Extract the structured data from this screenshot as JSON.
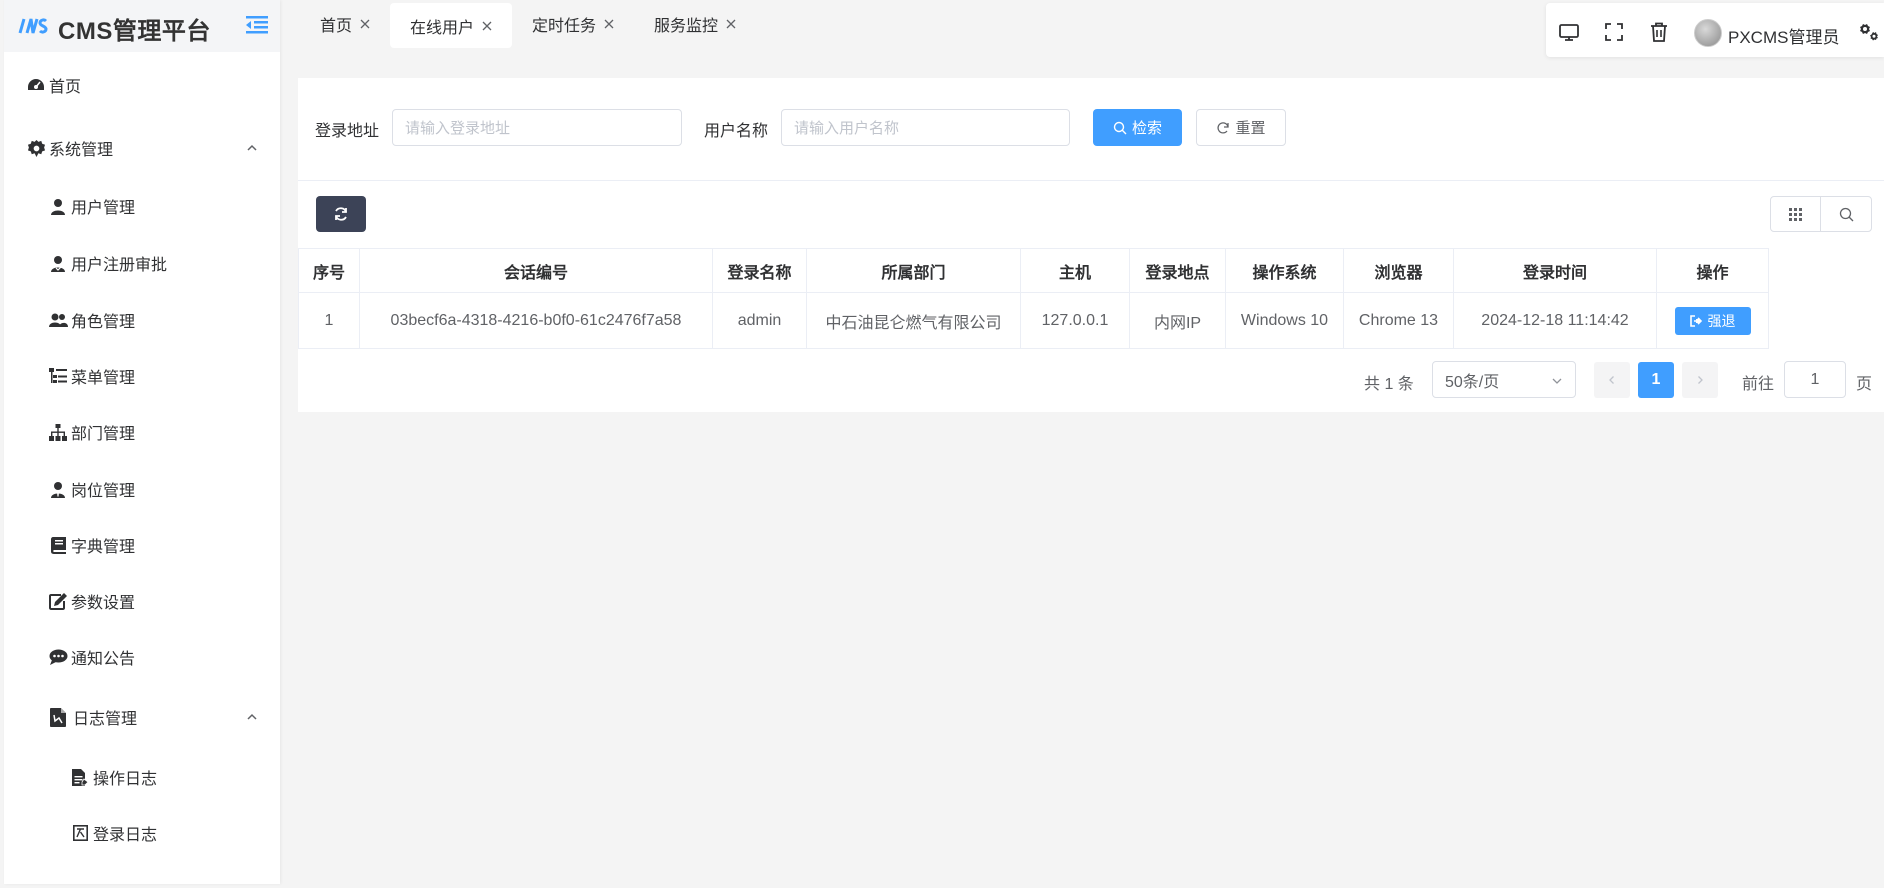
{
  "app": {
    "title": "CMS管理平台"
  },
  "colors": {
    "primary": "#409eff",
    "dark_button": "#3c4357",
    "sidebar_bg": "#ffffff",
    "page_bg": "#f4f4f4"
  },
  "sidebar": {
    "items": [
      {
        "label": "首页",
        "icon": "dashboard-icon"
      },
      {
        "label": "系统管理",
        "icon": "gear-icon",
        "expanded": true
      },
      {
        "label": "用户管理",
        "icon": "user-icon"
      },
      {
        "label": "用户注册审批",
        "icon": "user-check-icon"
      },
      {
        "label": "角色管理",
        "icon": "users-icon"
      },
      {
        "label": "菜单管理",
        "icon": "tree-list-icon"
      },
      {
        "label": "部门管理",
        "icon": "sitemap-icon"
      },
      {
        "label": "岗位管理",
        "icon": "user-tie-icon"
      },
      {
        "label": "字典管理",
        "icon": "book-icon"
      },
      {
        "label": "参数设置",
        "icon": "edit-icon"
      },
      {
        "label": "通知公告",
        "icon": "comments-icon"
      },
      {
        "label": "日志管理",
        "icon": "log-file-icon",
        "expanded": true
      },
      {
        "label": "操作日志",
        "icon": "file-text-icon"
      },
      {
        "label": "登录日志",
        "icon": "login-log-icon"
      }
    ]
  },
  "tabs": [
    {
      "label": "首页"
    },
    {
      "label": "在线用户",
      "active": true
    },
    {
      "label": "定时任务"
    },
    {
      "label": "服务监控"
    }
  ],
  "toolbar": {
    "username": "PXCMS管理员"
  },
  "search": {
    "ip_label": "登录地址",
    "ip_placeholder": "请输入登录地址",
    "user_label": "用户名称",
    "user_placeholder": "请输入用户名称",
    "search_button": "检索",
    "reset_button": "重置"
  },
  "table": {
    "headers": [
      "序号",
      "会话编号",
      "登录名称",
      "所属部门",
      "主机",
      "登录地点",
      "操作系统",
      "浏览器",
      "登录时间",
      "操作"
    ],
    "rows": [
      {
        "index": "1",
        "session_id": "03becf6a-4318-4216-b0f0-61c2476f7a58",
        "login_name": "admin",
        "dept": "中石油昆仑燃气有限公司",
        "host": "127.0.0.1",
        "location": "内网IP",
        "os": "Windows 10",
        "browser": "Chrome 13",
        "login_time": "2024-12-18 11:14:42",
        "action": "强退"
      }
    ]
  },
  "pagination": {
    "total": "共 1 条",
    "page_size": "50条/页",
    "current_page": "1",
    "goto_label": "前往",
    "goto_value": "1",
    "goto_suffix": "页"
  }
}
